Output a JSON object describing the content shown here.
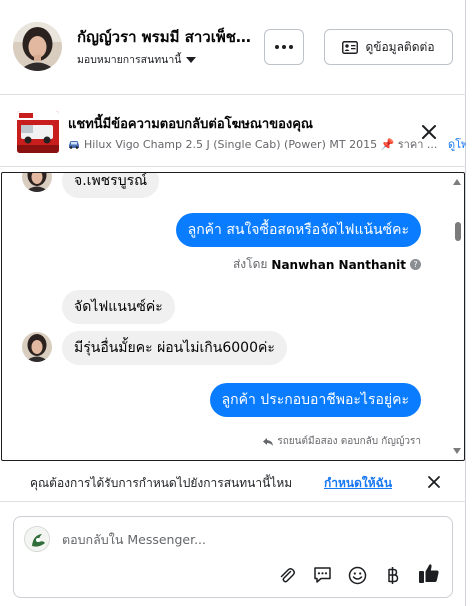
{
  "header": {
    "contact_name": "กัญญ์วรา พรมมี สาวเพ็ชรบูรณ์",
    "assign_label": "มอบหมายการสนทนานี้",
    "more_label": "···",
    "info_button_label": "ดูข้อมูลติดต่อ"
  },
  "ad": {
    "title": "แชทนี้มีข้อความตอบกลับต่อโฆษณาของคุณ",
    "subtitle": "Hilux Vigo Champ 2.5 J (Single Cab) (Power) MT 2015 📌 ราคา ...",
    "reply_link": "ดูโพ"
  },
  "messages": [
    {
      "id": "m1",
      "direction": "in",
      "text": "จ.เพชรบูรณ์"
    },
    {
      "id": "m2",
      "direction": "out",
      "text": "ลูกค้า สนใจซื้อสดหรือจัดไฟแน้นซ์คะ"
    },
    {
      "id": "m3",
      "direction": "in",
      "text": "จัดไฟแนนซ์ค่ะ"
    },
    {
      "id": "m4",
      "direction": "in",
      "text": "มีรุ่นอื่นมั้ยคะ ผ่อนไม่เกิน6000ค่ะ"
    },
    {
      "id": "m5",
      "direction": "out",
      "text": "ลูกค้า ประกอบอาชีพอะไรอยู่คะ"
    }
  ],
  "sent_by": {
    "prefix": "ส่งโดย",
    "name": "Nanwhan Nanthanit",
    "info_glyph": "?"
  },
  "reply_note": "รถยนต์มือสอง ตอบกลับ กัญญ์วรา",
  "assign_prompt": {
    "question": "คุณต้องการได้รับการกำหนดไปยังการสนทนานี้ไหม",
    "link": "กำหนดให้ฉัน"
  },
  "composer": {
    "placeholder": "ตอบกลับใน Messenger..."
  },
  "toolbar_icons": [
    "paperclip-icon",
    "saved-reply-icon",
    "emoji-icon",
    "baht-icon",
    "thumbs-up-icon"
  ],
  "colors": {
    "accent": "#0a7cff",
    "link": "#1877f2",
    "incoming_bubble": "#f0f0f0"
  }
}
